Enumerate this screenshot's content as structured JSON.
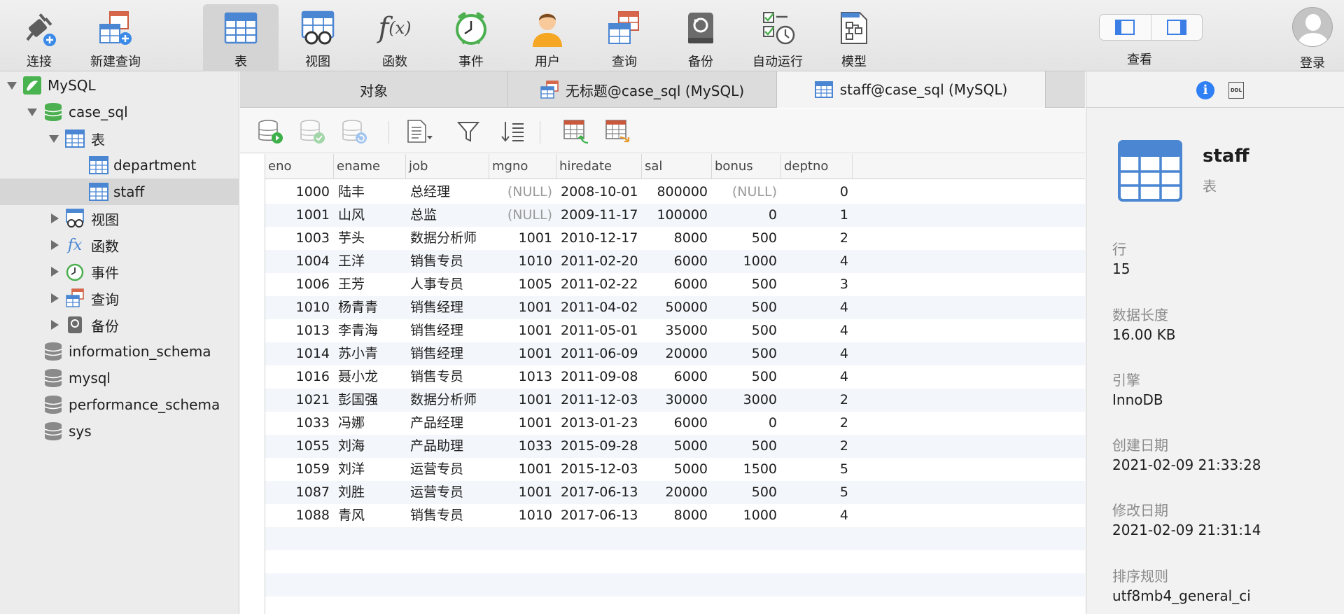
{
  "toolbar": {
    "items": [
      {
        "label": "连接",
        "icon": "connection-plug-icon"
      },
      {
        "label": "新建查询",
        "icon": "new-query-icon"
      },
      {
        "label": "表",
        "icon": "table-icon"
      },
      {
        "label": "视图",
        "icon": "view-glasses-icon"
      },
      {
        "label": "函数",
        "icon": "function-fx-icon"
      },
      {
        "label": "事件",
        "icon": "event-clock-icon"
      },
      {
        "label": "用户",
        "icon": "user-icon"
      },
      {
        "label": "查询",
        "icon": "query-icon"
      },
      {
        "label": "备份",
        "icon": "backup-icon"
      },
      {
        "label": "自动运行",
        "icon": "auto-run-icon"
      },
      {
        "label": "模型",
        "icon": "model-icon"
      }
    ],
    "active": "表",
    "view_label": "查看",
    "login_label": "登录"
  },
  "sidebar": {
    "connection": "MySQL",
    "database": "case_sql",
    "tables_group": "表",
    "tables": [
      "department",
      "staff"
    ],
    "selected_table": "staff",
    "groups": [
      "视图",
      "函数",
      "事件",
      "查询",
      "备份"
    ],
    "other_databases": [
      "information_schema",
      "mysql",
      "performance_schema",
      "sys"
    ]
  },
  "tabs": [
    {
      "label": "对象"
    },
    {
      "label": "无标题@case_sql (MySQL)"
    },
    {
      "label": "staff@case_sql (MySQL)"
    }
  ],
  "table": {
    "columns": [
      "eno",
      "ename",
      "job",
      "mgno",
      "hiredate",
      "sal",
      "bonus",
      "deptno"
    ],
    "rows": [
      [
        "1000",
        "陆丰",
        "总经理",
        "(NULL)",
        "2008-10-01",
        "800000",
        "(NULL)",
        "0"
      ],
      [
        "1001",
        "山风",
        "总监",
        "(NULL)",
        "2009-11-17",
        "100000",
        "0",
        "1"
      ],
      [
        "1003",
        "芋头",
        "数据分析师",
        "1001",
        "2010-12-17",
        "8000",
        "500",
        "2"
      ],
      [
        "1004",
        "王洋",
        "销售专员",
        "1010",
        "2011-02-20",
        "6000",
        "1000",
        "4"
      ],
      [
        "1006",
        "王芳",
        "人事专员",
        "1005",
        "2011-02-22",
        "6000",
        "500",
        "3"
      ],
      [
        "1010",
        "杨青青",
        "销售经理",
        "1001",
        "2011-04-02",
        "50000",
        "500",
        "4"
      ],
      [
        "1013",
        "李青海",
        "销售经理",
        "1001",
        "2011-05-01",
        "35000",
        "500",
        "4"
      ],
      [
        "1014",
        "苏小青",
        "销售经理",
        "1001",
        "2011-06-09",
        "20000",
        "500",
        "4"
      ],
      [
        "1016",
        "聂小龙",
        "销售专员",
        "1013",
        "2011-09-08",
        "6000",
        "500",
        "4"
      ],
      [
        "1021",
        "彭国强",
        "数据分析师",
        "1001",
        "2011-12-03",
        "30000",
        "3000",
        "2"
      ],
      [
        "1033",
        "冯娜",
        "产品经理",
        "1001",
        "2013-01-23",
        "6000",
        "0",
        "2"
      ],
      [
        "1055",
        "刘海",
        "产品助理",
        "1033",
        "2015-09-28",
        "5000",
        "500",
        "2"
      ],
      [
        "1059",
        "刘洋",
        "运营专员",
        "1001",
        "2015-12-03",
        "5000",
        "1500",
        "5"
      ],
      [
        "1087",
        "刘胜",
        "运营专员",
        "1001",
        "2017-06-13",
        "20000",
        "500",
        "5"
      ],
      [
        "1088",
        "青风",
        "销售专员",
        "1010",
        "2017-06-13",
        "8000",
        "1000",
        "4"
      ]
    ]
  },
  "info_panel": {
    "name": "staff",
    "type": "表",
    "properties": [
      {
        "label": "行",
        "value": "15"
      },
      {
        "label": "数据长度",
        "value": "16.00 KB"
      },
      {
        "label": "引擎",
        "value": "InnoDB"
      },
      {
        "label": "创建日期",
        "value": "2021-02-09 21:33:28"
      },
      {
        "label": "修改日期",
        "value": "2021-02-09 21:31:14"
      },
      {
        "label": "排序规则",
        "value": "utf8mb4_general_ci"
      }
    ],
    "ddl_label": "DDL"
  },
  "colors": {
    "accent": "#2f7ff5",
    "table_icon": "#4a86d2",
    "db_green": "#4caf50",
    "null_text": "#9a9a9a"
  }
}
